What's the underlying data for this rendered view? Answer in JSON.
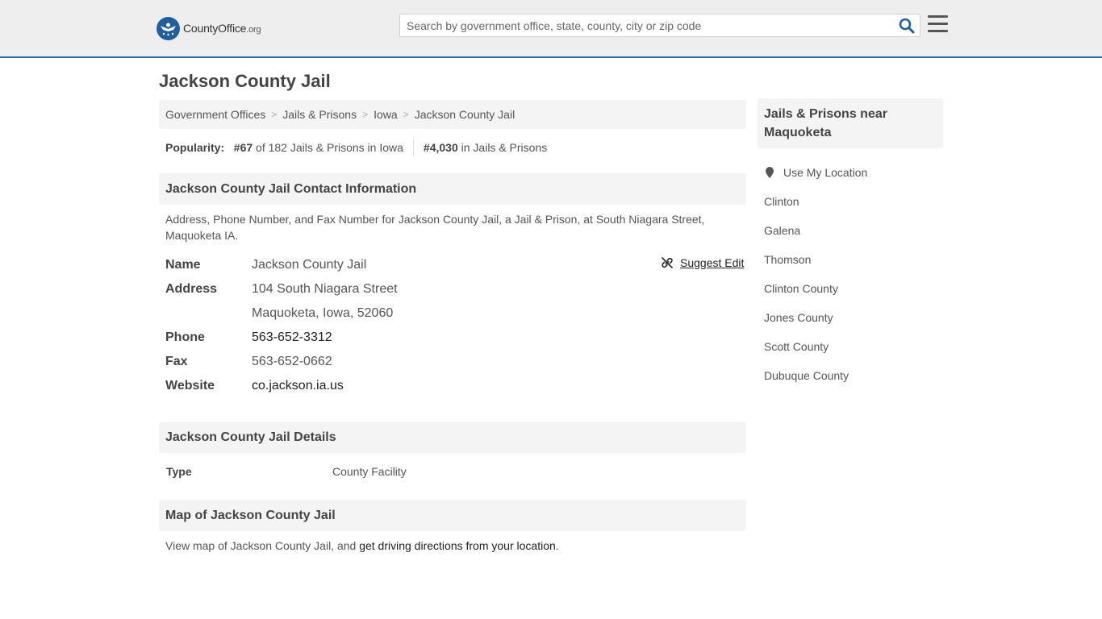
{
  "header": {
    "logo_county": "CountyOffice",
    "logo_org": ".org",
    "search_placeholder": "Search by government office, state, county, city or zip code"
  },
  "page": {
    "title": "Jackson County Jail"
  },
  "breadcrumb": [
    "Government Offices",
    "Jails & Prisons",
    "Iowa",
    "Jackson County Jail"
  ],
  "popularity": {
    "label": "Popularity:",
    "state_rank": "#67",
    "state_text": "of 182 Jails & Prisons in Iowa",
    "national_rank": "#4,030",
    "national_text": "in Jails & Prisons"
  },
  "contact": {
    "heading": "Jackson County Jail Contact Information",
    "description": "Address, Phone Number, and Fax Number for Jackson County Jail, a Jail & Prison, at South Niagara Street, Maquoketa IA.",
    "suggest_edit": "Suggest Edit",
    "name_label": "Name",
    "name": "Jackson County Jail",
    "address_label": "Address",
    "address_line1": "104 South Niagara Street",
    "address_line2": "Maquoketa, Iowa, 52060",
    "phone_label": "Phone",
    "phone": "563-652-3312",
    "fax_label": "Fax",
    "fax": "563-652-0662",
    "website_label": "Website",
    "website": "co.jackson.ia.us"
  },
  "details": {
    "heading": "Jackson County Jail Details",
    "type_label": "Type",
    "type_value": "County Facility"
  },
  "map": {
    "heading": "Map of Jackson County Jail",
    "text_before": "View map of Jackson County Jail, and ",
    "link": "get driving directions from your location",
    "text_after": "."
  },
  "sidebar": {
    "heading": "Jails & Prisons near Maquoketa",
    "use_location": "Use My Location",
    "links": [
      "Clinton",
      "Galena",
      "Thomson",
      "Clinton County",
      "Jones County",
      "Scott County",
      "Dubuque County"
    ]
  }
}
